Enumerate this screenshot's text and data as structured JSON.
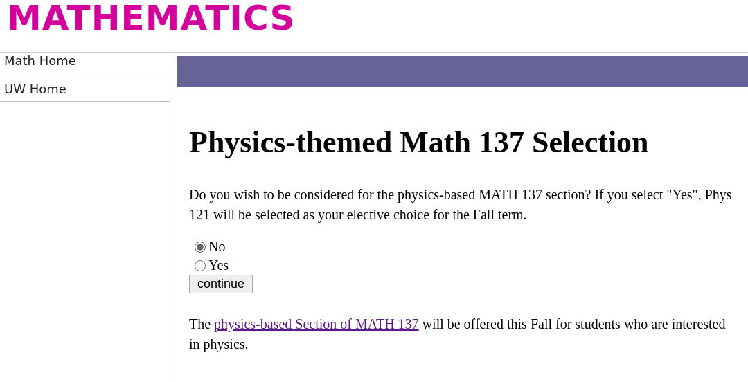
{
  "logo": {
    "text": "MATHEMATICS"
  },
  "sidebar": {
    "items": [
      {
        "label": "Math Home"
      },
      {
        "label": "UW Home"
      }
    ]
  },
  "main": {
    "heading": "Physics-themed Math 137 Selection",
    "question": "Do you wish to be considered for the physics-based MATH 137 section? If you select \"Yes\", Phys 121 will be selected as your elective choice for the Fall term.",
    "options": [
      {
        "label": "No",
        "selected": true
      },
      {
        "label": "Yes",
        "selected": false
      }
    ],
    "button": "continue",
    "note": {
      "before": "The ",
      "link": "physics-based Section of MATH 137",
      "after": " will be offered this Fall for students who are interested in physics."
    }
  }
}
